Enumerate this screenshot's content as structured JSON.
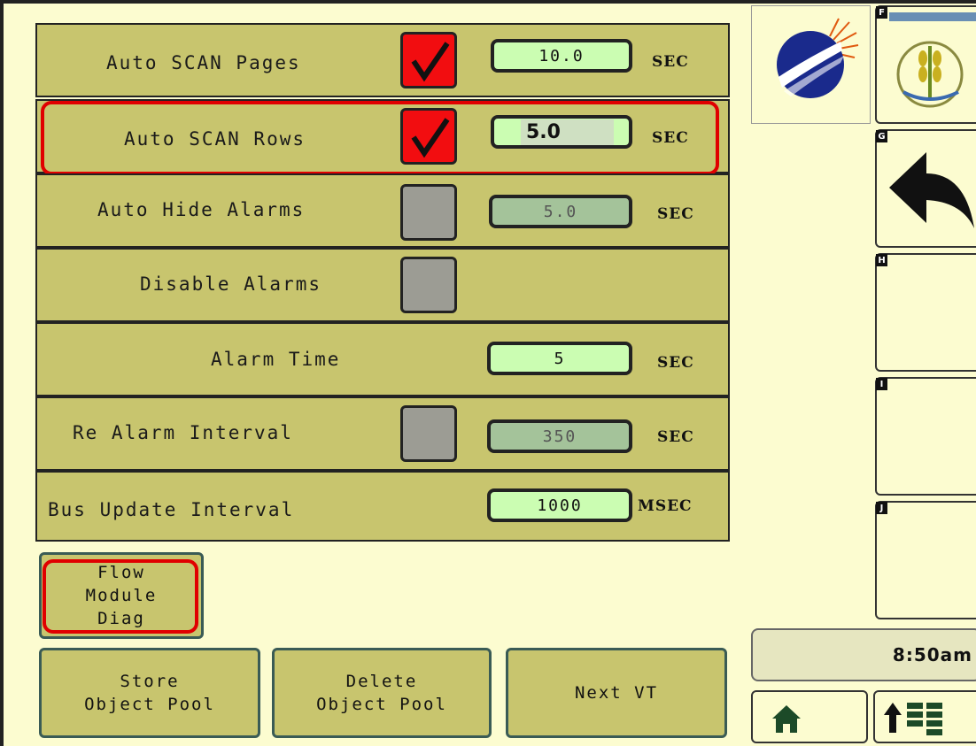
{
  "settings": {
    "rows": [
      {
        "label": "Auto SCAN Pages",
        "checked": true,
        "value": "10.0",
        "unit": "SEC"
      },
      {
        "label": "Auto SCAN Rows",
        "checked": true,
        "value": "5.0",
        "unit": "SEC"
      },
      {
        "label": "Auto Hide Alarms",
        "checked": false,
        "value": "5.0",
        "unit": "SEC"
      },
      {
        "label": "Disable Alarms",
        "checked": false
      },
      {
        "label": "Alarm Time",
        "value": "5",
        "unit": "SEC"
      },
      {
        "label": "Re Alarm Interval",
        "checked": false,
        "value": "350",
        "unit": "SEC"
      },
      {
        "label": "Bus Update Interval",
        "value": "1000",
        "unit": "MSEC"
      }
    ]
  },
  "buttons": {
    "flow_module": [
      "Flow",
      "Module",
      "Diag"
    ],
    "store_pool": [
      "Store",
      "Object Pool"
    ],
    "delete_pool": [
      "Delete",
      "Object Pool"
    ],
    "next_vt": "Next VT"
  },
  "soft_keys": {
    "f": "F",
    "g": "G",
    "h": "H",
    "i": "I",
    "j": "J",
    "g_icon": "back-arrow-icon",
    "f_icon": "crop-logo-icon"
  },
  "status": {
    "time": "8:50am"
  },
  "nav": {
    "home_icon": "home-icon",
    "menu_icon": "up-arrow-grid-icon"
  },
  "colors": {
    "panel": "#c8c56e",
    "checked": "#f20d10",
    "field_active": "#cbfdb2",
    "highlight": "#e00000"
  }
}
